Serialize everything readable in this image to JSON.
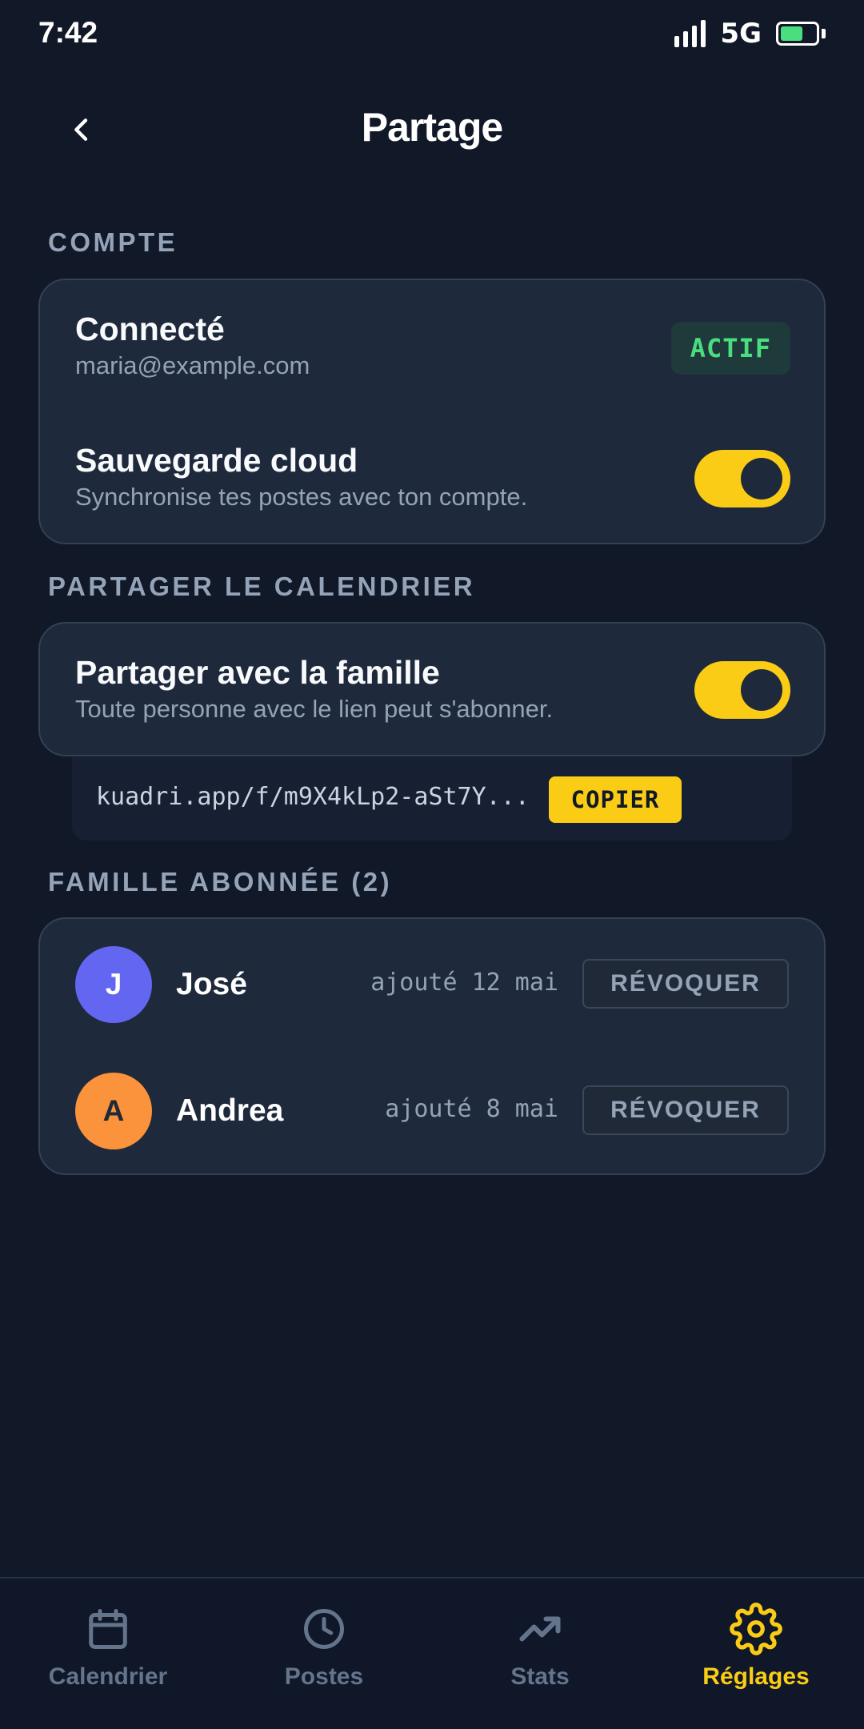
{
  "status_bar": {
    "time": "7:42",
    "network": "5G",
    "battery_level": 0.65
  },
  "header": {
    "title": "Partage",
    "back_icon": "chevron-left-icon"
  },
  "account_section": {
    "label": "COMPTE",
    "connected": {
      "title": "Connecté",
      "email": "maria@example.com",
      "badge": "ACTIF"
    },
    "cloud_backup": {
      "title": "Sauvegarde cloud",
      "subtitle": "Synchronise tes postes avec ton compte.",
      "enabled": true
    }
  },
  "share_section": {
    "label": "PARTAGER LE CALENDRIER",
    "family_share": {
      "title": "Partager avec la famille",
      "subtitle": "Toute personne avec le lien peut s'abonner.",
      "enabled": true
    },
    "link": "kuadri.app/f/m9X4kLp2-aSt7Y...",
    "copy_label": "COPIER"
  },
  "family_section": {
    "label": "FAMILLE ABONNÉE (2)",
    "members": [
      {
        "initial": "J",
        "name": "José",
        "added": "ajouté 12 mai",
        "action": "RÉVOQUER",
        "color": "#6366f1",
        "text_color": "#ffffff"
      },
      {
        "initial": "A",
        "name": "Andrea",
        "added": "ajouté 8 mai",
        "action": "RÉVOQUER",
        "color": "#fb923c",
        "text_color": "#1f2937"
      }
    ]
  },
  "bottom_nav": {
    "items": [
      {
        "label": "Calendrier",
        "icon": "calendar-icon",
        "active": false
      },
      {
        "label": "Postes",
        "icon": "clock-icon",
        "active": false
      },
      {
        "label": "Stats",
        "icon": "trending-up-icon",
        "active": false
      },
      {
        "label": "Réglages",
        "icon": "gear-icon",
        "active": true
      }
    ]
  },
  "colors": {
    "background": "#111827",
    "card": "#1e293b",
    "accent": "#facc15",
    "success": "#4ade80",
    "muted": "#94a3b8"
  }
}
